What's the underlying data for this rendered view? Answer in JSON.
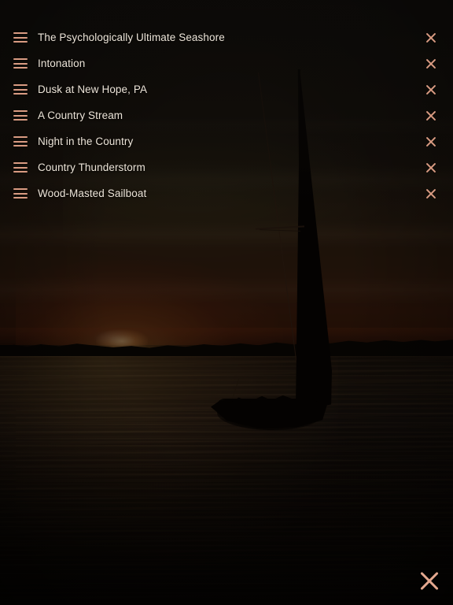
{
  "screen": {
    "name": "ambient-sound-playlist-overlay",
    "background_description": "sailboat silhouette at sunset over water",
    "colors": {
      "accent": "#d99b82",
      "close_accent": "#e3a78e",
      "track_text": "#ece4d8",
      "backdrop": "#0a0806",
      "sky_top": "#1b1813",
      "sky_horizon": "#3d1d0d",
      "water": "#20160e"
    }
  },
  "playlist": {
    "drag_handle_icon": "hamburger-drag-icon",
    "remove_icon": "close-x-icon",
    "tracks": [
      {
        "title": "The Psychologically Ultimate Seashore"
      },
      {
        "title": "Intonation"
      },
      {
        "title": "Dusk at New Hope, PA"
      },
      {
        "title": "A Country Stream"
      },
      {
        "title": "Night in the Country"
      },
      {
        "title": "Country Thunderstorm"
      },
      {
        "title": "Wood-Masted Sailboat"
      }
    ]
  },
  "close_button": {
    "icon": "close-x-icon",
    "label": "Close"
  }
}
